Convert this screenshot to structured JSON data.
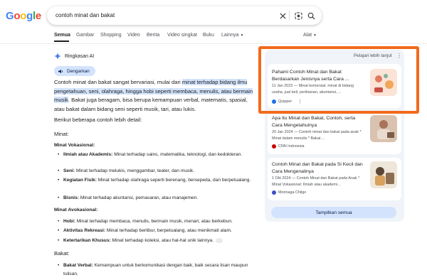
{
  "header": {
    "logo": "Google",
    "query": "contoh minat dan bakat"
  },
  "tabs": {
    "items": [
      "Semua",
      "Gambar",
      "Shopping",
      "Video",
      "Berita",
      "Video singkat",
      "Buku",
      "Lainnya"
    ],
    "tools": "Alat"
  },
  "ai": {
    "title": "Ringkasan AI",
    "listen": "Dengarkan",
    "intro_a": "Contoh minat dan bakat sangat bervariasi, mulai dari ",
    "intro_hl": "minat terhadap bidang ilmu pengetahuan, seni, olahraga, hingga hobi seperti membaca, menulis, atau bermain musik",
    "intro_b": ". Bakat juga beragam, bisa berupa kemampuan verbal, matematis, spasial, atau bakat dalam bidang seni seperti musik, tari, atau lukis.",
    "lead": "Berikut beberapa contoh lebih detail:",
    "minat_heading": "Minat:",
    "vokasional_heading": "Minat Vokasional:",
    "vokasional": [
      {
        "term": "Ilmiah atau Akademis:",
        "desc": " Minat terhadap sains, matematika, teknologi, dan kedokteran."
      },
      {
        "term": "Seni:",
        "desc": " Minat terhadap melukis, menggambar, teater, dan musik."
      },
      {
        "term": "Kegiatan Fisik:",
        "desc": " Minat terhadap olahraga seperti berenang, bersepeda, dan berpetualang."
      },
      {
        "term": "Bisnis:",
        "desc": " Minat terhadap akuntansi, pemasaran, atau manajemen."
      }
    ],
    "avokasional_heading": "Minat Avokasional:",
    "avokasional": [
      {
        "term": "Hobi:",
        "desc": " Minat terhadap membaca, menulis, bermain musik, menari, atau berkebun."
      },
      {
        "term": "Aktivitas Rekreasi:",
        "desc": " Minat terhadap berlibur, berpetualang, atau menikmati alam."
      },
      {
        "term": "Ketertarikan Khusus:",
        "desc": " Minat terhadap koleksi, atau hal-hal unik lainnya."
      }
    ],
    "bakat_heading": "Bakat:",
    "bakat": [
      {
        "term": "Bakat Verbal:",
        "desc": " Kemampuan untuk berkomunikasi dengan baik, baik secara lisan maupun tulisan."
      }
    ]
  },
  "panel": {
    "learn_more": "Pelajari lebih lanjut",
    "cards": [
      {
        "title": "Pahami Contoh Minat dan Bakat Berdasarkan Jenisnya serta Cara ...",
        "snippet": "11 Jan 2023 — Minat komersial. minat di bidang usaha, jual beli, perikianan, akuntansi, ...",
        "source": "Quipper",
        "source_color": "#1a73e8"
      },
      {
        "title": "Apa Itu Minat dan Bakat, Contoh, serta Cara Mengetahuinya",
        "snippet": "20 Jan 2024 — Contoh minat dan bakat pada anak * Minat dalam menulis * Bakat ...",
        "source": "CNN Indonesia",
        "source_color": "#cc0000"
      },
      {
        "title": "Contoh Minat dan Bakat pada Si Kecil dan Cara Mengenalinya",
        "snippet": "1 Okt 2024 — Contoh Minat dan Bakat pada Anak * Minat Vokasional: Ilmiah atau akademi...",
        "source": "Morinaga Chilgo",
        "source_color": "#3c4ec8"
      }
    ],
    "show_all": "Tampilkan semua"
  }
}
